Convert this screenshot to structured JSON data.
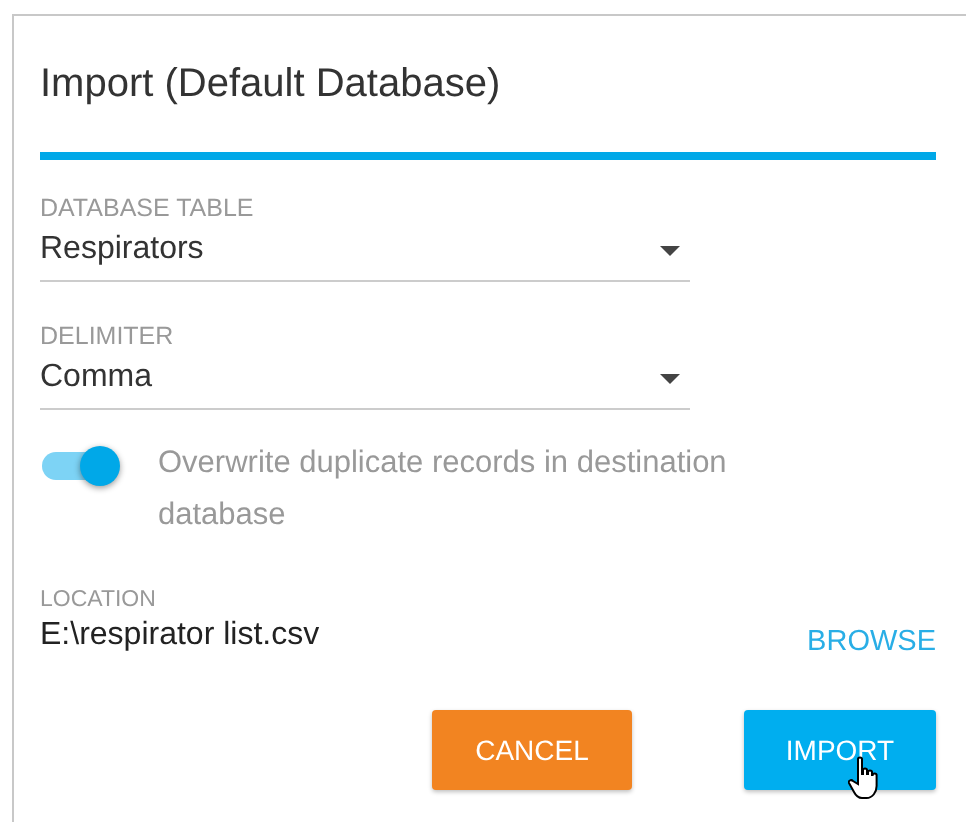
{
  "dialog": {
    "title": "Import (Default Database)"
  },
  "fields": [
    {
      "label": "DATABASE TABLE",
      "value": "Respirators"
    },
    {
      "label": "DELIMITER",
      "value": "Comma"
    }
  ],
  "overwrite_toggle": {
    "label": "Overwrite duplicate records in destination database",
    "on": true
  },
  "location": {
    "label": "LOCATION",
    "value": "E:\\respirator list.csv",
    "action": "BROWSE"
  },
  "buttons": [
    {
      "label": "CANCEL",
      "kind": "secondary"
    },
    {
      "label": "IMPORT",
      "kind": "primary"
    }
  ]
}
